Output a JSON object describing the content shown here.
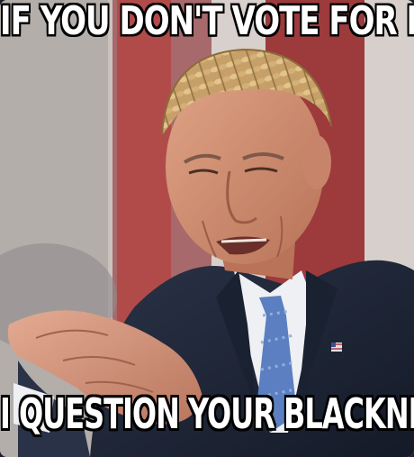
{
  "meme": {
    "top_text": "IF YOU DON'T VOTE FOR ME",
    "bottom_text": "I QUESTION YOUR BLACKNESS"
  },
  "colors": {
    "caption_fill": "#ffffff",
    "caption_outline": "#000000",
    "flag_red": "#9c3a3c",
    "suit": "#1e2536",
    "tie": "#5b7fc0",
    "shirt": "#eef0f4"
  },
  "icons": [
    "flag-pin-icon"
  ]
}
